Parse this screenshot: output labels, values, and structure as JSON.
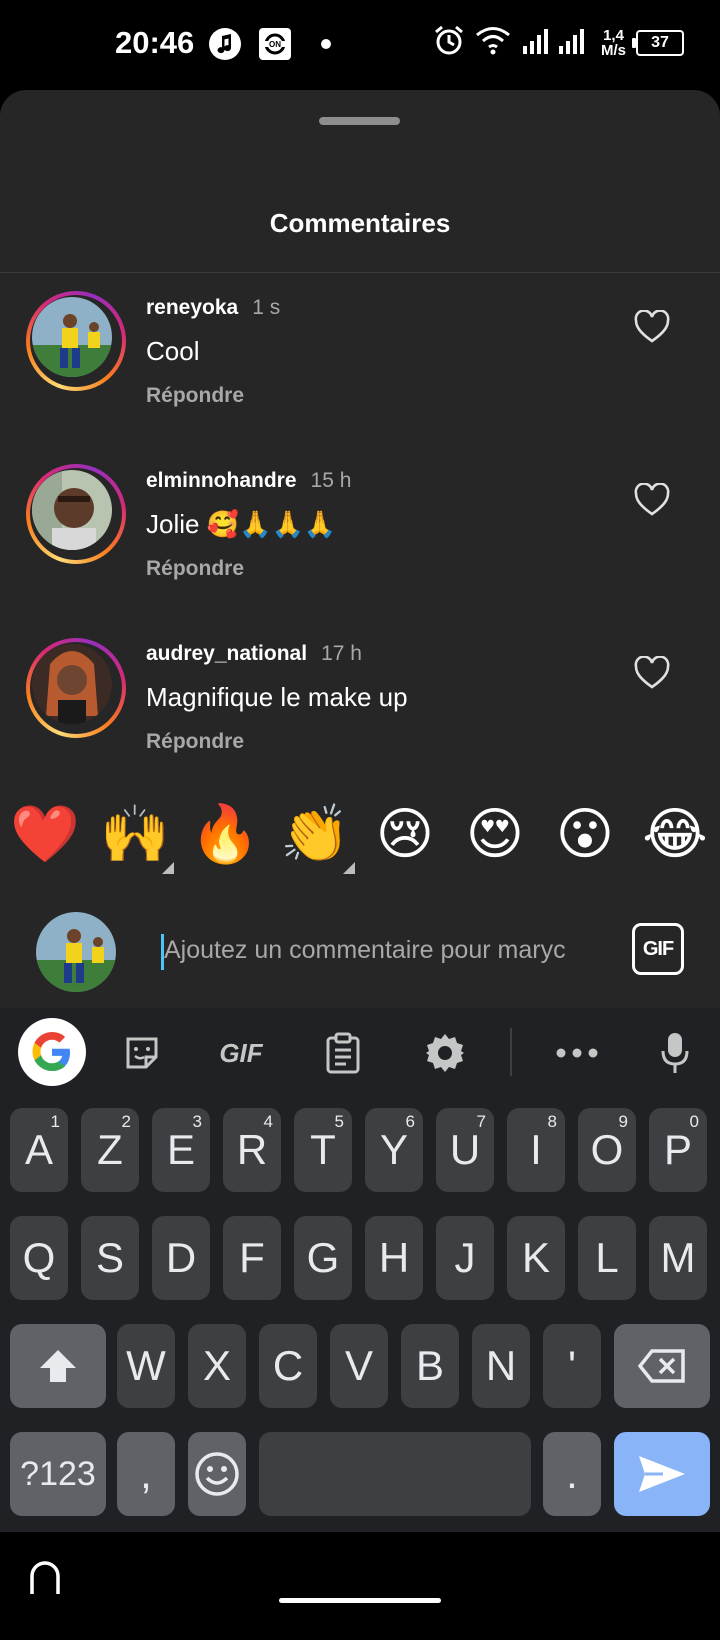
{
  "status_bar": {
    "time": "20:46",
    "speed": "1,4",
    "speed_unit": "M/s",
    "battery": "37"
  },
  "sheet": {
    "title": "Commentaires"
  },
  "comments": [
    {
      "username": "reneyoka",
      "time": "1 s",
      "text": "Cool",
      "reply": "Répondre"
    },
    {
      "username": "elminnohandre",
      "time": "15 h",
      "text": "Jolie 🥰🙏🙏🙏",
      "reply": "Répondre"
    },
    {
      "username": "audrey_national",
      "time": "17 h",
      "text": "Magnifique le make up",
      "reply": "Répondre"
    }
  ],
  "quick_emojis": [
    "❤️",
    "🙌",
    "🔥",
    "👏",
    "😢",
    "😍",
    "😮",
    "😂"
  ],
  "input": {
    "placeholder": "Ajoutez un commentaire pour maryc",
    "gif_label": "GIF"
  },
  "keyboard": {
    "toolbar_gif": "GIF",
    "row1": [
      [
        "A",
        "1"
      ],
      [
        "Z",
        "2"
      ],
      [
        "E",
        "3"
      ],
      [
        "R",
        "4"
      ],
      [
        "T",
        "5"
      ],
      [
        "Y",
        "6"
      ],
      [
        "U",
        "7"
      ],
      [
        "I",
        "8"
      ],
      [
        "O",
        "9"
      ],
      [
        "P",
        "0"
      ]
    ],
    "row2": [
      "Q",
      "S",
      "D",
      "F",
      "G",
      "H",
      "J",
      "K",
      "L",
      "M"
    ],
    "row3": [
      "W",
      "X",
      "C",
      "V",
      "B",
      "N",
      "'"
    ],
    "symbols": "?123",
    "comma": ",",
    "period": "."
  },
  "colors": {
    "sheet_bg": "#262626",
    "key_bg": "#3c4043",
    "send_bg": "#8ab4f8"
  }
}
